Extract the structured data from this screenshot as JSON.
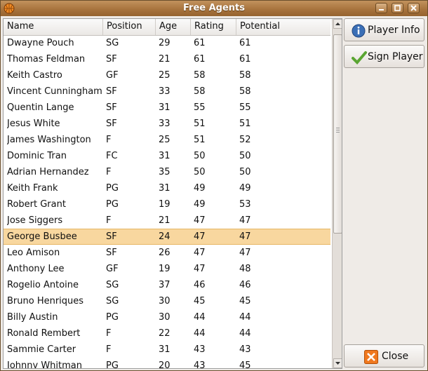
{
  "window": {
    "title": "Free Agents"
  },
  "table": {
    "columns": [
      "Name",
      "Position",
      "Age",
      "Rating",
      "Potential"
    ],
    "rows": [
      [
        "Dwayne Pouch",
        "SG",
        "29",
        "61",
        "61"
      ],
      [
        "Thomas Feldman",
        "SF",
        "21",
        "61",
        "61"
      ],
      [
        "Keith Castro",
        "GF",
        "25",
        "58",
        "58"
      ],
      [
        "Vincent Cunningham",
        "SF",
        "33",
        "58",
        "58"
      ],
      [
        "Quentin Lange",
        "SF",
        "31",
        "55",
        "55"
      ],
      [
        "Jesus White",
        "SF",
        "33",
        "51",
        "51"
      ],
      [
        "James Washington",
        "F",
        "25",
        "51",
        "52"
      ],
      [
        "Dominic Tran",
        "FC",
        "31",
        "50",
        "50"
      ],
      [
        "Adrian Hernandez",
        "F",
        "35",
        "50",
        "50"
      ],
      [
        "Keith Frank",
        "PG",
        "31",
        "49",
        "49"
      ],
      [
        "Robert Grant",
        "PG",
        "19",
        "49",
        "53"
      ],
      [
        "Jose Siggers",
        "F",
        "21",
        "47",
        "47"
      ],
      [
        "George Busbee",
        "SF",
        "24",
        "47",
        "47"
      ],
      [
        "Leo Amison",
        "SF",
        "26",
        "47",
        "47"
      ],
      [
        "Anthony Lee",
        "GF",
        "19",
        "47",
        "48"
      ],
      [
        "Rogelio Antoine",
        "SG",
        "37",
        "46",
        "46"
      ],
      [
        "Bruno Henriques",
        "SG",
        "30",
        "45",
        "45"
      ],
      [
        "Billy Austin",
        "PG",
        "30",
        "44",
        "44"
      ],
      [
        "Ronald Rembert",
        "F",
        "22",
        "44",
        "44"
      ],
      [
        "Sammie Carter",
        "F",
        "31",
        "43",
        "43"
      ],
      [
        "Johnny Whitman",
        "PG",
        "20",
        "43",
        "45"
      ]
    ],
    "selected_row": 12
  },
  "buttons": {
    "player_info": "Player Info",
    "sign_player": "Sign Player",
    "close": "Close"
  },
  "icons": {
    "app": "basketball-icon",
    "player_info": "info-icon",
    "sign_player": "checkmark-icon",
    "close": "close-x-icon"
  },
  "colors": {
    "titlebar": "#a8743e",
    "selection": "#f8d79f",
    "close_icon": "#f0781e",
    "info_icon": "#3b6fb6",
    "check_icon": "#5aa532"
  }
}
